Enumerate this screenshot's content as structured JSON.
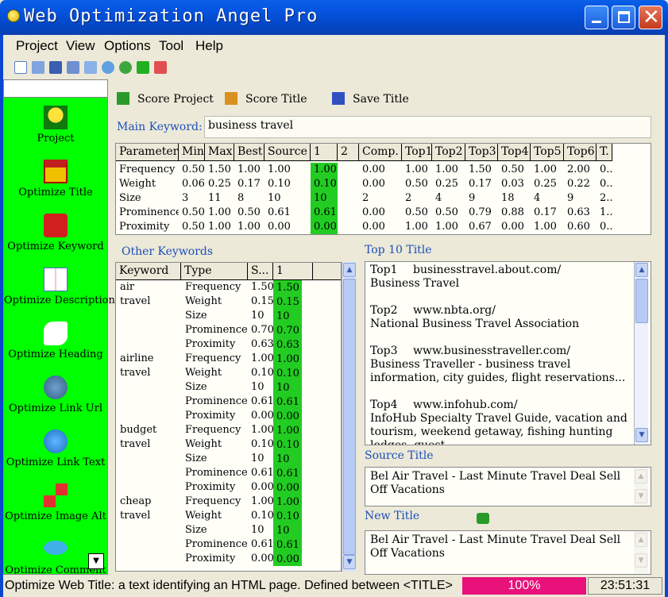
{
  "window": {
    "title": "Web Optimization Angel Pro"
  },
  "menu": [
    "Project",
    "View",
    "Options",
    "Tool",
    "Help"
  ],
  "toolbar_icons": [
    "new-icon",
    "open-icon",
    "save-icon",
    "save-as-icon",
    "edit-icon",
    "refresh-icon",
    "help-icon",
    "download-icon",
    "exit-icon"
  ],
  "sidebar": {
    "items": [
      {
        "label": "Project",
        "icon": "project-icon"
      },
      {
        "label": "Optimize Title",
        "icon": "title-house-icon"
      },
      {
        "label": "Optimize Keyword",
        "icon": "keyword-dice-icon"
      },
      {
        "label": "Optimize Description",
        "icon": "description-book-icon"
      },
      {
        "label": "Optimize Heading",
        "icon": "heading-icon"
      },
      {
        "label": "Optimize Link Url",
        "icon": "link-url-icon"
      },
      {
        "label": "Optimize Link Text",
        "icon": "link-text-icon"
      },
      {
        "label": "Optimize Image Alt",
        "icon": "image-alt-icon"
      },
      {
        "label": "Optimize Comment",
        "icon": "comment-icon"
      }
    ]
  },
  "actions": {
    "score_project": "Score Project",
    "score_title": "Score Title",
    "save_title": "Save Title"
  },
  "main_keyword": {
    "label": "Main Keyword:",
    "value": "business travel"
  },
  "param_table": {
    "headers": [
      "Parameter",
      "Min",
      "Max",
      "Best",
      "Source",
      "1",
      "2",
      "Comp.",
      "Top1",
      "Top2",
      "Top3",
      "Top4",
      "Top5",
      "Top6",
      "T."
    ],
    "rows": [
      [
        "Frequency",
        "0.50",
        "1.50",
        "1.00",
        "1.00",
        "1.00",
        "",
        "0.00",
        "1.00",
        "1.00",
        "1.50",
        "0.50",
        "1.00",
        "2.00",
        "0..."
      ],
      [
        "Weight",
        "0.06",
        "0.25",
        "0.17",
        "0.10",
        "0.10",
        "",
        "0.00",
        "0.50",
        "0.25",
        "0.17",
        "0.03",
        "0.25",
        "0.22",
        "0..."
      ],
      [
        "Size",
        "3",
        "11",
        "8",
        "10",
        "10",
        "",
        "2",
        "2",
        "4",
        "9",
        "18",
        "4",
        "9",
        "2..."
      ],
      [
        "Prominence",
        "0.50",
        "1.00",
        "0.50",
        "0.61",
        "0.61",
        "",
        "0.00",
        "0.50",
        "0.50",
        "0.79",
        "0.88",
        "0.17",
        "0.63",
        "1..."
      ],
      [
        "Proximity",
        "0.50",
        "1.00",
        "1.00",
        "0.00",
        "0.00",
        "",
        "0.00",
        "1.00",
        "1.00",
        "0.67",
        "0.00",
        "1.00",
        "0.60",
        "0..."
      ]
    ]
  },
  "other_keywords": {
    "label": "Other Keywords",
    "headers": [
      "Keyword",
      "Type",
      "S...",
      "1"
    ],
    "groups": [
      {
        "line1": "air",
        "line2": "travel",
        "rows": [
          [
            "Frequency",
            "1.50",
            "1.50"
          ],
          [
            "Weight",
            "0.15",
            "0.15"
          ],
          [
            "Size",
            "10",
            "10"
          ],
          [
            "Prominence",
            "0.70",
            "0.70"
          ],
          [
            "Proximity",
            "0.63",
            "0.63"
          ]
        ]
      },
      {
        "line1": "airline",
        "line2": "travel",
        "rows": [
          [
            "Frequency",
            "1.00",
            "1.00"
          ],
          [
            "Weight",
            "0.10",
            "0.10"
          ],
          [
            "Size",
            "10",
            "10"
          ],
          [
            "Prominence",
            "0.61",
            "0.61"
          ],
          [
            "Proximity",
            "0.00",
            "0.00"
          ]
        ]
      },
      {
        "line1": "budget",
        "line2": "travel",
        "rows": [
          [
            "Frequency",
            "1.00",
            "1.00"
          ],
          [
            "Weight",
            "0.10",
            "0.10"
          ],
          [
            "Size",
            "10",
            "10"
          ],
          [
            "Prominence",
            "0.61",
            "0.61"
          ],
          [
            "Proximity",
            "0.00",
            "0.00"
          ]
        ]
      },
      {
        "line1": "cheap",
        "line2": "travel",
        "rows": [
          [
            "Frequency",
            "1.00",
            "1.00"
          ],
          [
            "Weight",
            "0.10",
            "0.10"
          ],
          [
            "Size",
            "10",
            "10"
          ],
          [
            "Prominence",
            "0.61",
            "0.61"
          ],
          [
            "Proximity",
            "0.00",
            "0.00"
          ]
        ]
      }
    ]
  },
  "top10": {
    "label": "Top 10 Title",
    "entries": [
      {
        "rank": "Top1",
        "url": "businesstravel.about.com/",
        "title": "Business Travel"
      },
      {
        "rank": "Top2",
        "url": "www.nbta.org/",
        "title": "National Business Travel Association"
      },
      {
        "rank": "Top3",
        "url": "www.businesstraveller.com/",
        "title": "Business Traveller - business travel information, city guides, flight reservations..."
      },
      {
        "rank": "Top4",
        "url": "www.infohub.com/",
        "title": "InfoHub Specialty Travel Guide, vacation and tourism, weekend getaway, fishing hunting lodges, guest"
      }
    ]
  },
  "source_title": {
    "label": "Source Title",
    "value": "Bel Air Travel - Last Minute Travel Deal Sell Off Vacations"
  },
  "new_title": {
    "label": "New Title",
    "value": "Bel Air Travel - Last Minute Travel Deal Sell Off Vacations"
  },
  "status": {
    "text": "Optimize Web Title: a text identifying an HTML page. Defined between <TITLE>",
    "progress": "100%",
    "progress_fraction": 1.0,
    "clock": "23:51:31"
  },
  "colors": {
    "sidebar_bg": "#00ff00",
    "highlight": "#22cc22",
    "progress": "#e8127a",
    "title_bar": "#0554e0"
  }
}
